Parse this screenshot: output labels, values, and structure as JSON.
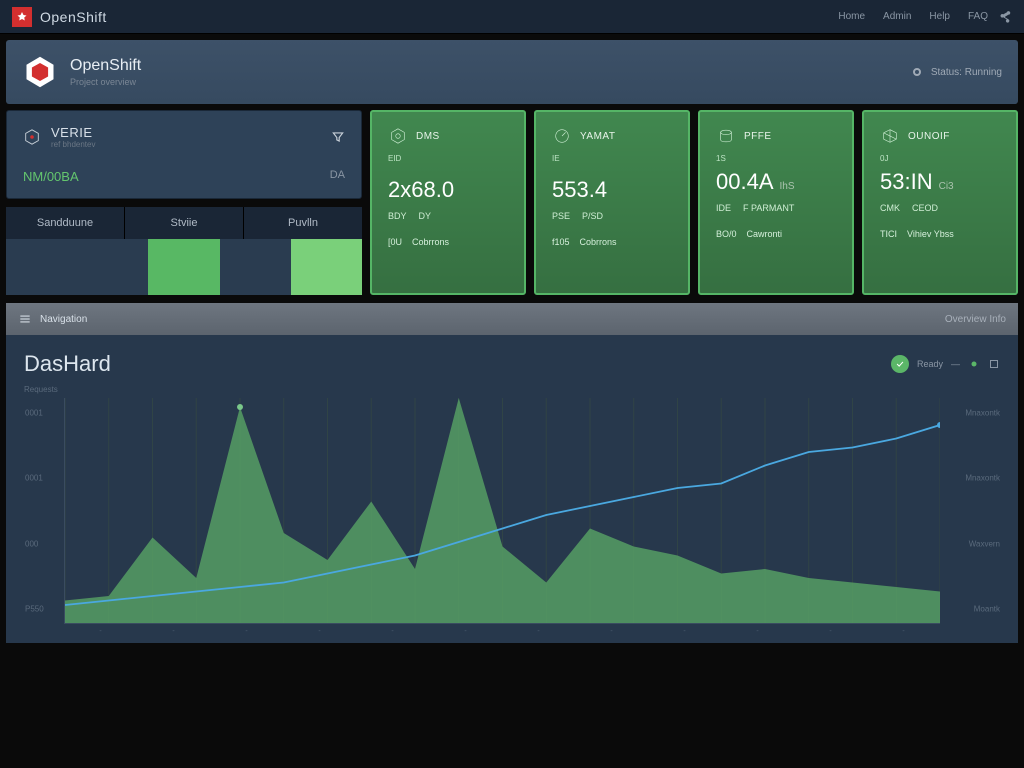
{
  "topbar": {
    "title": "OpenShift",
    "nav": [
      "Home",
      "Admin",
      "Help",
      "FAQ"
    ]
  },
  "projectbar": {
    "title": "OpenShift",
    "subtitle": "Project overview",
    "status": "Status: Running"
  },
  "left_card": {
    "title": "VERIE",
    "subtitle": "ref bhdentev",
    "value": "NM/00BA",
    "right": "DA"
  },
  "tabs": [
    "Sandduune",
    "Stviie",
    "Puvlln"
  ],
  "swatches": [
    "#2a3c50",
    "#2a3c50",
    "#58b864",
    "#2a3c50",
    "#7ad07a"
  ],
  "metrics": [
    {
      "title": "DMS",
      "sub": "EID",
      "big": "2x68.0",
      "row": [
        "BDY",
        "DY"
      ],
      "foot": [
        "[0U",
        "Cobrrons"
      ]
    },
    {
      "title": "YAMAT",
      "sub": "IE",
      "big": "553.4",
      "row": [
        "PSE",
        "P/SD"
      ],
      "foot": [
        "f105",
        "Cobrrons"
      ]
    },
    {
      "title": "PFFE",
      "sub": "1S",
      "big": "00.4A",
      "side": "IhS",
      "row": [
        "IDE",
        "F PARMANT"
      ],
      "foot": [
        "BO/0",
        "Cawronti"
      ]
    },
    {
      "title": "OUNOIF",
      "sub": "0J",
      "big": "53:IN",
      "side": "Ci3",
      "row": [
        "CMK",
        "CEOD"
      ],
      "foot": [
        "TICI",
        "Vihiev Ybss"
      ]
    }
  ],
  "lower_bar": {
    "left": "Navigation",
    "right": "Overview Info"
  },
  "dashboard": {
    "title": "DasHard",
    "badge_label": "Ready",
    "ylabel": "Requests"
  },
  "chart_data": {
    "type": "line",
    "title": "DasHard",
    "ylabel": "Requests",
    "x": [
      0,
      1,
      2,
      3,
      4,
      5,
      6,
      7,
      8,
      9,
      10,
      11,
      12,
      13,
      14,
      15,
      16,
      17,
      18,
      19,
      20
    ],
    "series": [
      {
        "name": "area",
        "type": "area",
        "values": [
          10,
          12,
          38,
          20,
          96,
          40,
          28,
          54,
          24,
          100,
          34,
          18,
          42,
          34,
          30,
          22,
          24,
          20,
          18,
          16,
          14
        ]
      },
      {
        "name": "line",
        "type": "line",
        "values": [
          8,
          10,
          12,
          14,
          16,
          18,
          22,
          26,
          30,
          36,
          42,
          48,
          52,
          56,
          60,
          62,
          70,
          76,
          78,
          82,
          88
        ]
      }
    ],
    "ylim": [
      0,
      100
    ],
    "yticks_left": [
      "0001",
      "0001",
      "000",
      "P550"
    ],
    "yticks_right": [
      "Mnaxontk",
      "Mnaxontk",
      "Waxvern",
      "Moantk"
    ],
    "xticks": [
      "-",
      "-",
      "-",
      "-",
      "-",
      "-",
      "-",
      "-",
      "-",
      "-",
      "-",
      "-"
    ]
  }
}
